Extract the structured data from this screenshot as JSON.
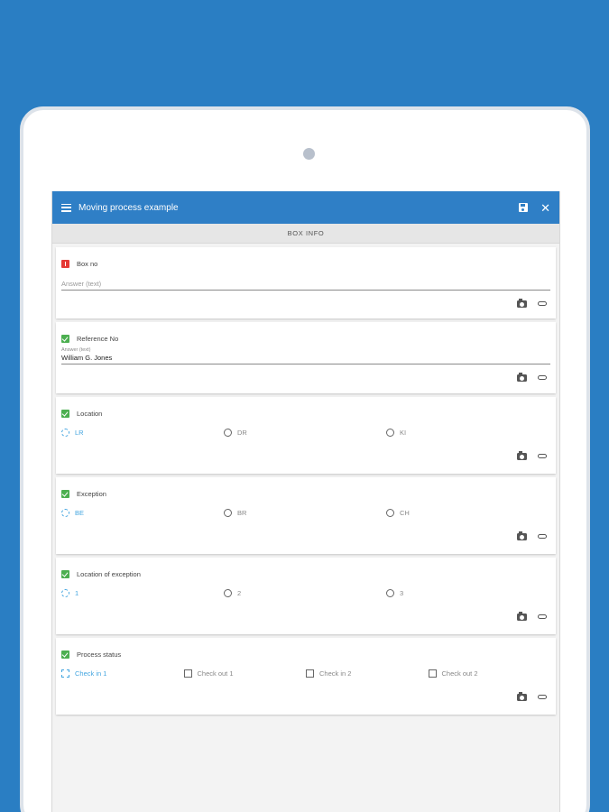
{
  "app": {
    "title": "Moving process example",
    "icons": {
      "menu": "menu-icon",
      "save": "save-icon",
      "close": "close-icon"
    },
    "accent_color": "#2f7fc6",
    "background_color": "#2a7ec3"
  },
  "section": {
    "title": "BOX INFO"
  },
  "questions": [
    {
      "label": "Box no",
      "status": "error",
      "placeholder": "Answer (text)",
      "value": ""
    },
    {
      "label": "Reference No",
      "status": "ok",
      "hint": "Answer (text)",
      "value": "William G. Jones"
    },
    {
      "label": "Location",
      "status": "ok",
      "type": "radio",
      "options": [
        "LR",
        "DR",
        "KI"
      ],
      "selected": "LR"
    },
    {
      "label": "Exception",
      "status": "ok",
      "type": "radio",
      "options": [
        "BE",
        "BR",
        "CH"
      ],
      "selected": "BE"
    },
    {
      "label": "Location of exception",
      "status": "ok",
      "type": "radio",
      "options": [
        "1",
        "2",
        "3"
      ],
      "selected": "1"
    },
    {
      "label": "Process status",
      "status": "ok",
      "type": "checkbox",
      "options": [
        "Check in 1",
        "Check out 1",
        "Check in 2",
        "Check out 2"
      ],
      "selected": "Check in 1"
    }
  ],
  "card_actions": {
    "camera": "camera-icon",
    "attach": "paperclip-icon"
  }
}
